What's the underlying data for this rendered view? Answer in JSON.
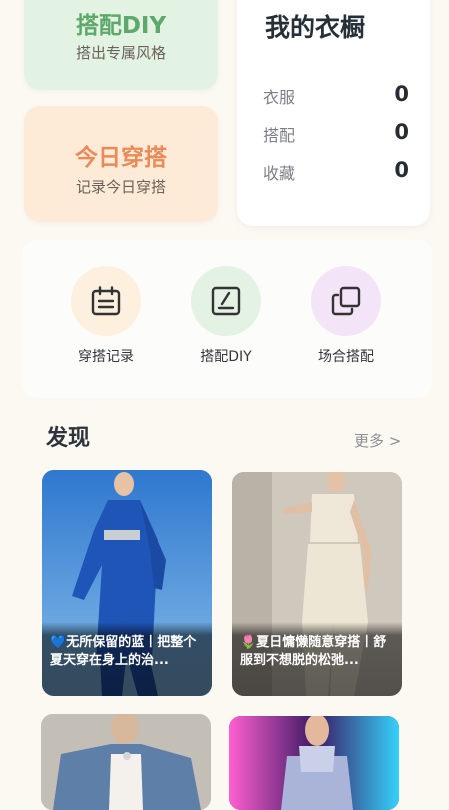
{
  "cards": {
    "diy": {
      "title": "搭配DIY",
      "subtitle": "搭出专属风格",
      "color": "#5ea86a"
    },
    "today": {
      "title": "今日穿搭",
      "subtitle": "记录今日穿搭",
      "color": "#e98a59"
    }
  },
  "wardrobe": {
    "title": "我的衣橱",
    "stats": [
      {
        "label": "衣服",
        "value": "0"
      },
      {
        "label": "搭配",
        "value": "0"
      },
      {
        "label": "收藏",
        "value": "0"
      }
    ]
  },
  "quick_actions": [
    {
      "label": "穿搭记录",
      "icon": "calendar-icon",
      "color": "#fdf0de"
    },
    {
      "label": "搭配DIY",
      "icon": "edit-icon",
      "color": "#e4f2e4"
    },
    {
      "label": "场合搭配",
      "icon": "copy-icon",
      "color": "#f3e4f7"
    }
  ],
  "discover": {
    "title": "发现",
    "more": "更多 >",
    "posts": [
      {
        "emoji": "💙",
        "caption": "无所保留的蓝丨把整个夏天穿在身上的治...",
        "image": "blue-outfit-photo"
      },
      {
        "emoji": "🌷",
        "caption": "夏日慵懒随意穿搭丨舒服到不想脱的松弛...",
        "image": "cream-outfit-photo"
      },
      {
        "image": "denim-jacket-photo"
      },
      {
        "image": "neon-outfit-photo"
      }
    ]
  }
}
